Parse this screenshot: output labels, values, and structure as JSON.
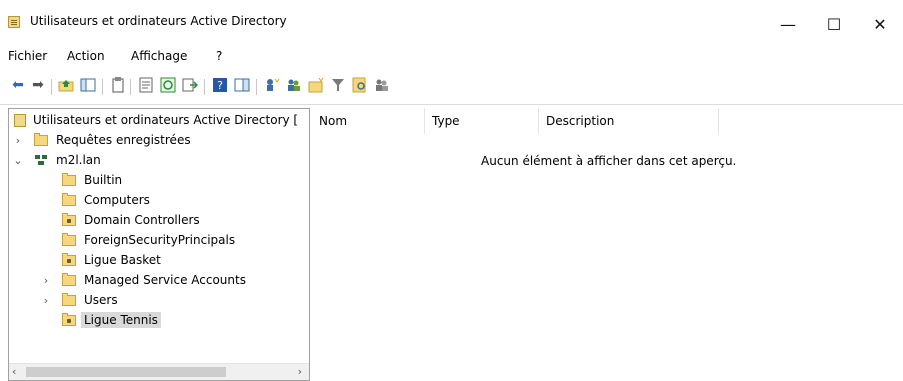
{
  "window": {
    "title": "Utilisateurs et ordinateurs Active Directory",
    "controls": {
      "minimize": "—",
      "maximize": "☐",
      "close": "✕"
    }
  },
  "menu": [
    "Fichier",
    "Action",
    "Affichage",
    "?"
  ],
  "toolbar": {
    "icons": [
      "back-arrow-icon",
      "forward-arrow-icon",
      "up-folder-icon",
      "show-hide-console-tree-icon",
      "clipboard-icon",
      "properties-icon",
      "refresh-icon",
      "export-list-icon",
      "help-icon",
      "console-tree-icon",
      "new-user-icon",
      "new-group-icon",
      "new-ou-icon",
      "filter-icon",
      "find-icon",
      "add-to-group-icon"
    ]
  },
  "tree": {
    "root": "Utilisateurs et ordinateurs Active Directory [",
    "saved_queries": "Requêtes enregistrées",
    "domain": "m2l.lan",
    "children": [
      {
        "label": "Builtin",
        "type": "container"
      },
      {
        "label": "Computers",
        "type": "container"
      },
      {
        "label": "Domain Controllers",
        "type": "ou"
      },
      {
        "label": "ForeignSecurityPrincipals",
        "type": "container"
      },
      {
        "label": "Ligue Basket",
        "type": "ou"
      },
      {
        "label": "Managed Service Accounts",
        "type": "container",
        "expandable": true
      },
      {
        "label": "Users",
        "type": "container",
        "expandable": true
      },
      {
        "label": "Ligue Tennis",
        "type": "ou",
        "selected": true
      }
    ]
  },
  "list": {
    "columns": [
      "Nom",
      "Type",
      "Description"
    ],
    "empty_message": "Aucun élément à afficher dans cet aperçu."
  }
}
